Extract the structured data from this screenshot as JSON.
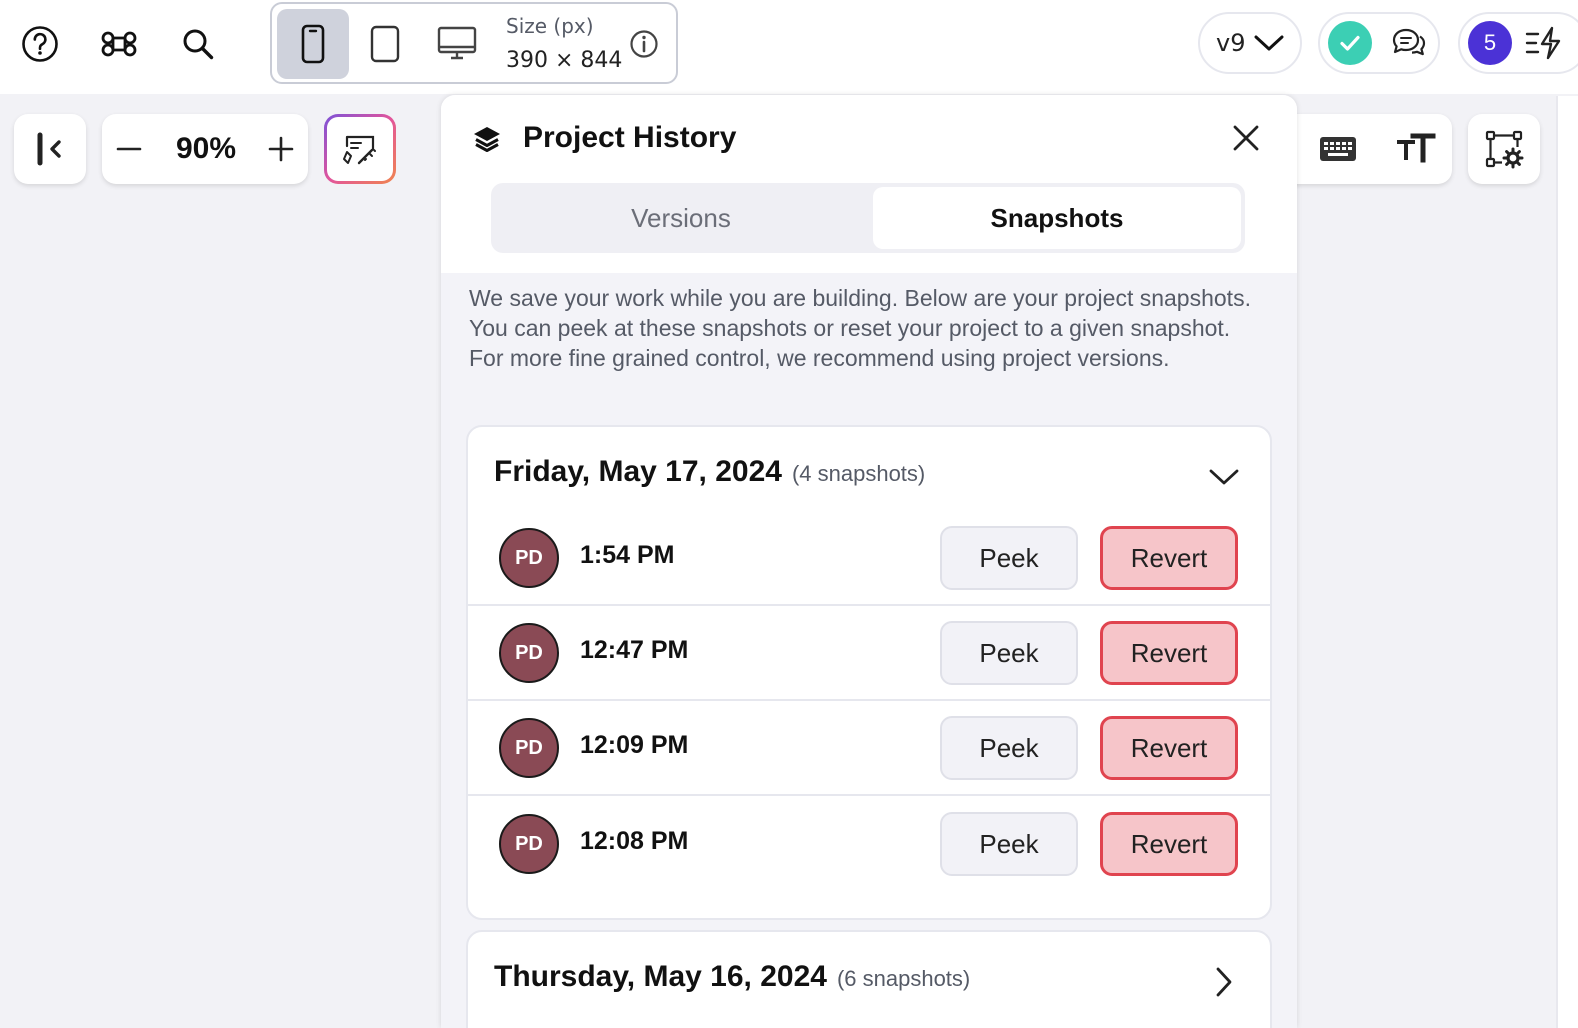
{
  "topbar": {
    "icons": [
      "help-icon",
      "command-icon",
      "search-icon"
    ],
    "device": {
      "size_label": "Size (px)",
      "size_value": "390 × 844",
      "selected": "phone"
    },
    "version": "v9",
    "collaborator_count": "5",
    "colors": {
      "status_ok": "#3ccfb4",
      "count_badge": "#4b32d6"
    }
  },
  "canvas": {
    "zoom": "90%"
  },
  "history": {
    "title": "Project History",
    "tabs": [
      {
        "label": "Versions",
        "active": false
      },
      {
        "label": "Snapshots",
        "active": true
      }
    ],
    "intro": "We save your work while you are building. Below are your project snapshots. You can peek at these snapshots or reset your project to a given snapshot. For more fine grained control, we recommend using project versions.",
    "days": [
      {
        "date": "Friday, May 17, 2024",
        "count_label": "(4 snapshots)",
        "expanded": true,
        "snapshots": [
          {
            "initials": "PD",
            "time": "1:54 PM",
            "peek": "Peek",
            "revert": "Revert"
          },
          {
            "initials": "PD",
            "time": "12:47 PM",
            "peek": "Peek",
            "revert": "Revert"
          },
          {
            "initials": "PD",
            "time": "12:09 PM",
            "peek": "Peek",
            "revert": "Revert"
          },
          {
            "initials": "PD",
            "time": "12:08 PM",
            "peek": "Peek",
            "revert": "Revert"
          }
        ]
      },
      {
        "date": "Thursday, May 16, 2024",
        "count_label": "(6 snapshots)",
        "expanded": false,
        "snapshots": []
      }
    ],
    "colors": {
      "avatar": "#8a4a55",
      "revert_bg": "#f6c5c9",
      "revert_border": "#e0444f"
    }
  }
}
